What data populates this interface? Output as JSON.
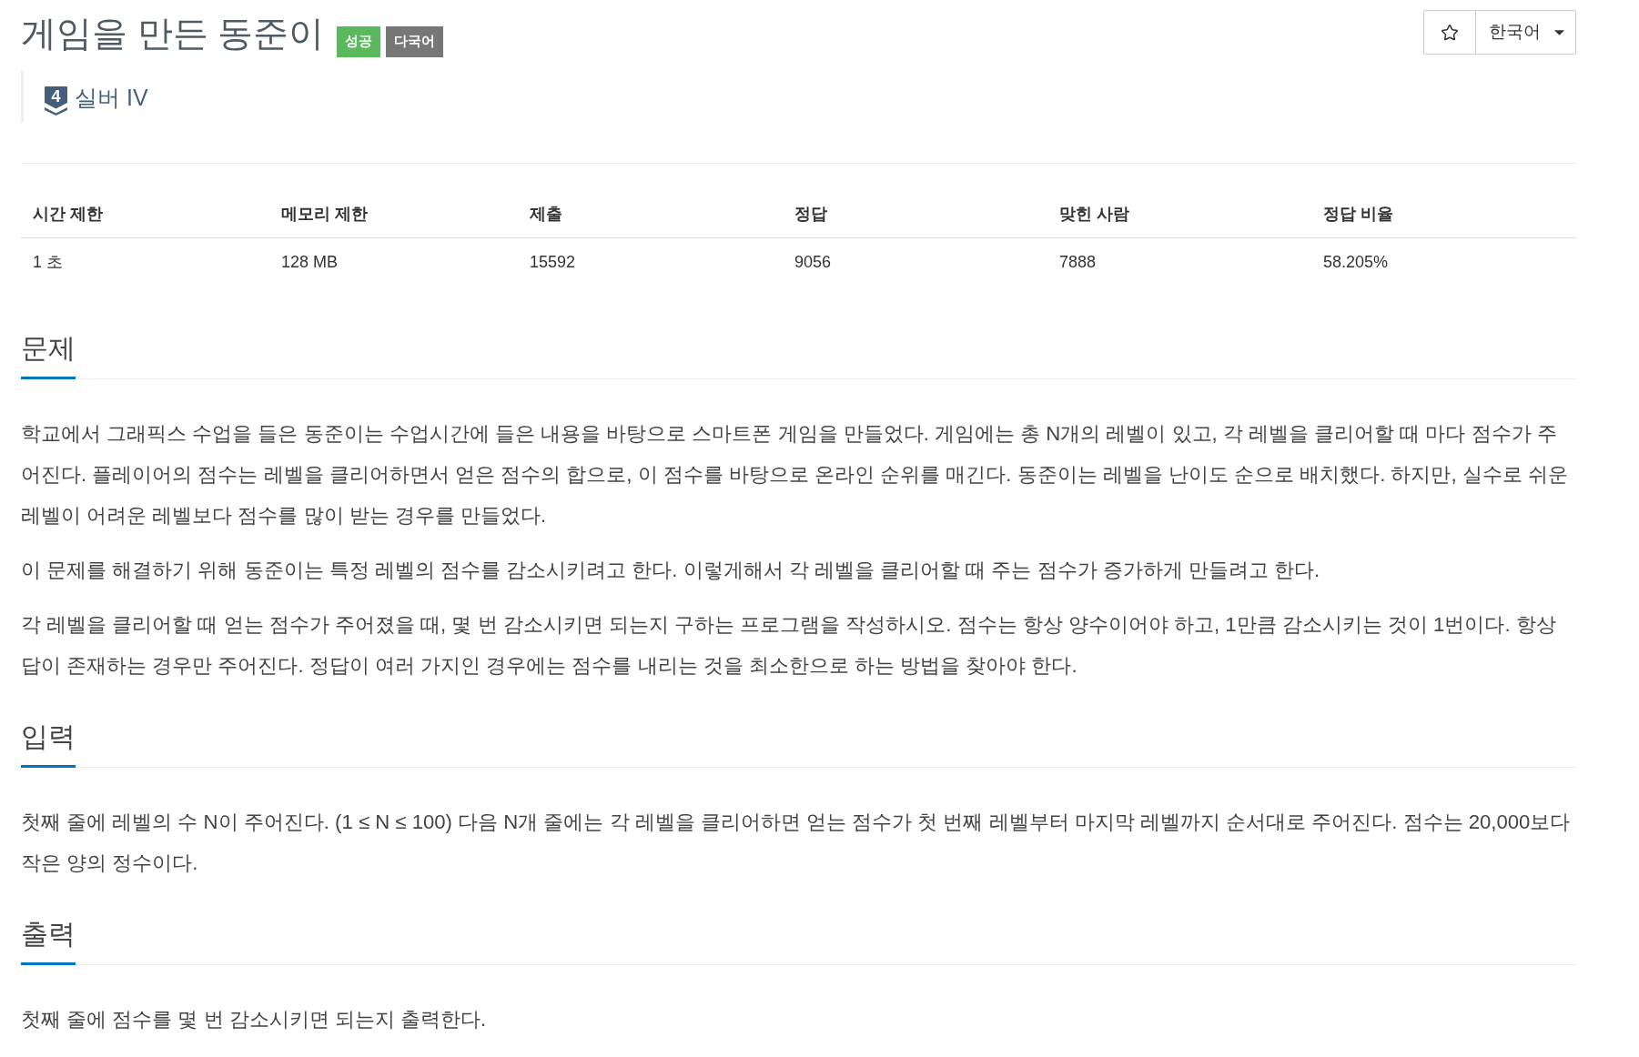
{
  "title": "게임을 만든 동준이",
  "badges": [
    {
      "label": "성공",
      "color": "#5cb85c"
    },
    {
      "label": "다국어",
      "color": "#777777"
    }
  ],
  "favorite": {
    "on": false
  },
  "language_menu": {
    "value": "한국어"
  },
  "tier": {
    "icon_text": "4",
    "label": "실버 IV"
  },
  "stats_table": {
    "columns": [
      "시간 제한",
      "메모리 제한",
      "제출",
      "정답",
      "맞힌 사람",
      "정답 비율"
    ],
    "rows": [
      [
        "1 초",
        "128 MB",
        "15592",
        "9056",
        "7888",
        "58.205%"
      ]
    ]
  },
  "sections": [
    {
      "heading": "문제",
      "paragraphs": [
        "학교에서 그래픽스 수업을 들은 동준이는 수업시간에 들은 내용을 바탕으로 스마트폰 게임을 만들었다. 게임에는 총 N개의 레벨이 있고, 각 레벨을 클리어할 때 마다 점수가 주어진다. 플레이어의 점수는 레벨을 클리어하면서 얻은 점수의 합으로, 이 점수를 바탕으로 온라인 순위를 매긴다. 동준이는 레벨을 난이도 순으로 배치했다. 하지만, 실수로 쉬운 레벨이 어려운 레벨보다 점수를 많이 받는 경우를 만들었다.",
        "이 문제를 해결하기 위해 동준이는 특정 레벨의 점수를 감소시키려고 한다. 이렇게해서 각 레벨을 클리어할 때 주는 점수가 증가하게 만들려고 한다.",
        "각 레벨을 클리어할 때 얻는 점수가 주어졌을 때, 몇 번 감소시키면 되는지 구하는 프로그램을 작성하시오. 점수는 항상 양수이어야 하고, 1만큼 감소시키는 것이 1번이다. 항상 답이 존재하는 경우만 주어진다. 정답이 여러 가지인 경우에는 점수를 내리는 것을 최소한으로 하는 방법을 찾아야 한다."
      ]
    },
    {
      "heading": "입력",
      "paragraphs": [
        "첫째 줄에 레벨의 수 N이 주어진다. (1 ≤ N ≤ 100) 다음 N개 줄에는 각 레벨을 클리어하면 얻는 점수가 첫 번째 레벨부터 마지막 레벨까지 순서대로 주어진다. 점수는 20,000보다 작은 양의 정수이다."
      ]
    },
    {
      "heading": "출력",
      "paragraphs": [
        "첫째 줄에 점수를 몇 번 감소시키면 되는지 출력한다."
      ]
    }
  ]
}
